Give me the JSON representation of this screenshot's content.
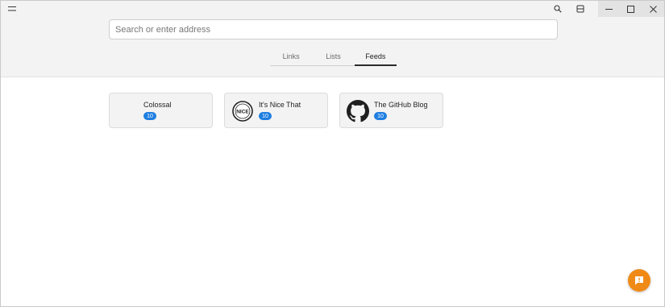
{
  "search": {
    "placeholder": "Search or enter address"
  },
  "tabs": [
    {
      "label": "Links",
      "active": false
    },
    {
      "label": "Lists",
      "active": false
    },
    {
      "label": "Feeds",
      "active": true
    }
  ],
  "feeds": [
    {
      "name": "Colossal",
      "count": "10",
      "icon": "blank-icon"
    },
    {
      "name": "It's Nice That",
      "count": "10",
      "icon": "nice-logo-icon",
      "logo_text": "NICE"
    },
    {
      "name": "The GitHub Blog",
      "count": "10",
      "icon": "github-icon"
    }
  ],
  "colors": {
    "accent": "#1f7ee0",
    "fab": "#f08a16",
    "header_bg": "#f3f3f3"
  }
}
